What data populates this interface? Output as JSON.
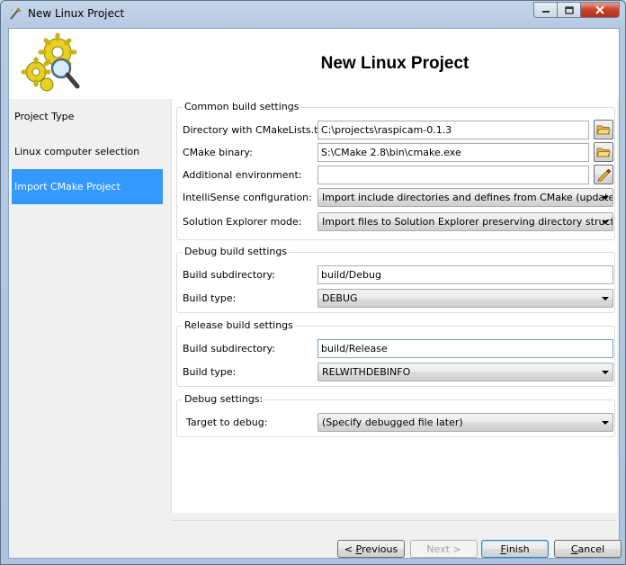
{
  "window": {
    "title": "New Linux Project",
    "caption_buttons": [
      "minimize-icon",
      "maximize-icon",
      "close-icon"
    ]
  },
  "header": {
    "title": "New Linux Project",
    "logo_icon": "gears-magnifier-icon"
  },
  "sidebar": {
    "items": [
      {
        "label": "Project Type",
        "active": false
      },
      {
        "label": "Linux computer selection",
        "active": false
      },
      {
        "label": "Import CMake Project",
        "active": true
      }
    ],
    "active_color": "#3399ff"
  },
  "common": {
    "legend": "Common build settings",
    "directory_label": "Directory with CMakeLists.txt:",
    "directory_value": "C:\\projects\\raspicam-0.1.3",
    "cmake_label": "CMake binary:",
    "cmake_value": "S:\\CMake 2.8\\bin\\cmake.exe",
    "env_label": "Additional environment:",
    "env_value": "",
    "intellisense_label": "IntelliSense configuration:",
    "intellisense_value": "Import include directories and defines from CMake (updated on build)",
    "explorer_label": "Solution Explorer mode:",
    "explorer_value": "Import files to Solution Explorer preserving directory structure."
  },
  "debug_build": {
    "legend": "Debug build settings",
    "subdir_label": "Build subdirectory:",
    "subdir_value": "build/Debug",
    "type_label": "Build type:",
    "type_value": "DEBUG"
  },
  "release_build": {
    "legend": "Release build settings",
    "subdir_label": "Build subdirectory:",
    "subdir_value": "build/Release",
    "type_label": "Build type:",
    "type_value": "RELWITHDEBINFO"
  },
  "debug_settings": {
    "legend": "Debug settings:",
    "target_label": "Target to debug:",
    "target_value": "(Specify debugged file later)"
  },
  "footer": {
    "previous_prefix": "< ",
    "previous_hotkey": "P",
    "previous_rest": "revious",
    "next_label": "Next >",
    "finish_hotkey": "F",
    "finish_rest": "inish",
    "cancel_hotkey": "C",
    "cancel_rest": "ancel"
  }
}
